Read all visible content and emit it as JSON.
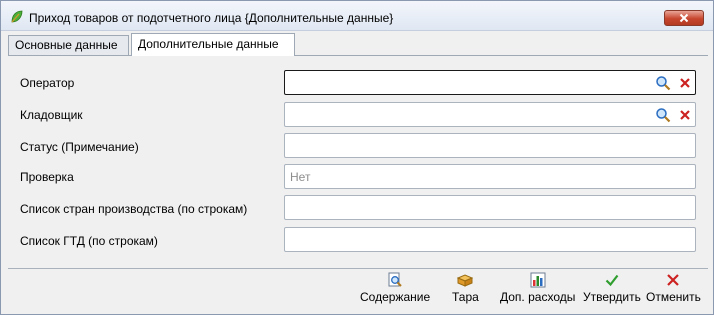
{
  "window": {
    "title": "Приход товаров от подотчетного лица {Дополнительные данные}"
  },
  "tabs": [
    {
      "label": "Основные данные",
      "active": false
    },
    {
      "label": "Дополнительные данные",
      "active": true
    }
  ],
  "fields": [
    {
      "label": "Оператор",
      "value": "",
      "has_select": true,
      "has_clear": true
    },
    {
      "label": "Кладовщик",
      "value": "",
      "has_select": true,
      "has_clear": true
    },
    {
      "label": "Статус (Примечание)",
      "value": ""
    },
    {
      "label": "Проверка",
      "value": "Нет"
    },
    {
      "label": "Список стран производства (по строкам)",
      "value": ""
    },
    {
      "label": "Список ГТД (по строкам)",
      "value": ""
    }
  ],
  "toolbar": {
    "contents_label": "Содержание",
    "tara_label": "Тара",
    "extra_costs_label": "Доп. расходы",
    "approve_label": "Утвердить",
    "cancel_label": "Отменить"
  },
  "icons": {
    "app": "leaf-icon",
    "select": "magnifier-icon",
    "clear": "red-x-icon",
    "contents": "document-search-icon",
    "tara": "box-icon",
    "extra_costs": "chart-icon",
    "approve": "green-check-icon",
    "cancel": "red-x-icon"
  },
  "colors": {
    "titlebar": "#dfe7f3",
    "close_button": "#c7462e",
    "window_bg": "#f0f0f0",
    "field_border": "#abb3bf",
    "placeholder_text": "#8d8d8d",
    "approve": "#2f9e2f",
    "cancel": "#cc2222"
  }
}
